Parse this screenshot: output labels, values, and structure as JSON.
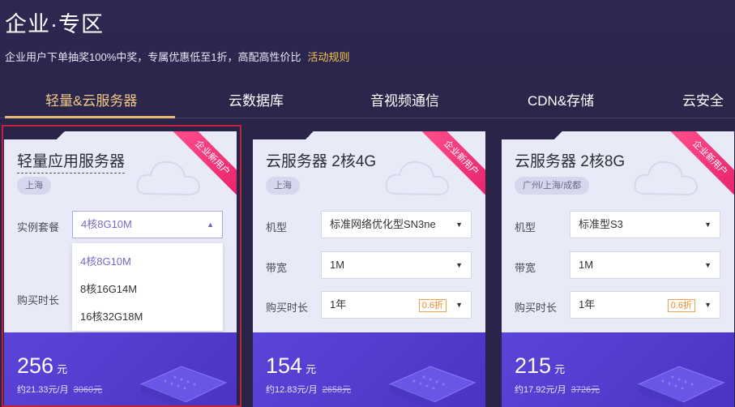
{
  "header": {
    "title": "企业·专区",
    "subtitle": "企业用户下单抽奖100%中奖，专属优惠低至1折，高配高性价比",
    "rule_link": "活动规则"
  },
  "tabs": [
    {
      "label": "轻量&云服务器",
      "active": true
    },
    {
      "label": "云数据库",
      "active": false
    },
    {
      "label": "音视频通信",
      "active": false
    },
    {
      "label": "CDN&存储",
      "active": false
    },
    {
      "label": "云安全",
      "active": false
    }
  ],
  "cards": [
    {
      "ribbon": "企业新用户",
      "name": "轻量应用服务器",
      "region": "上海",
      "rows": [
        {
          "label": "实例套餐",
          "value": "4核8G10M",
          "open": true
        },
        {
          "label": "购买时长",
          "value": ""
        }
      ],
      "dropdown": [
        "4核8G10M",
        "8核16G14M",
        "16核32G18M"
      ],
      "price": "256",
      "price_unit": "元",
      "monthly": "约21.33元/月",
      "original": "3060元"
    },
    {
      "ribbon": "企业新用户",
      "name": "云服务器 2核4G",
      "region": "上海",
      "rows": [
        {
          "label": "机型",
          "value": "标准网络优化型SN3ne"
        },
        {
          "label": "带宽",
          "value": "1M"
        },
        {
          "label": "购买时长",
          "value": "1年",
          "discount": "0.6折"
        }
      ],
      "price": "154",
      "price_unit": "元",
      "monthly": "约12.83元/月",
      "original": "2658元"
    },
    {
      "ribbon": "企业新用户",
      "name": "云服务器 2核8G",
      "region": "广州/上海/成都",
      "rows": [
        {
          "label": "机型",
          "value": "标准型S3"
        },
        {
          "label": "带宽",
          "value": "1M"
        },
        {
          "label": "购买时长",
          "value": "1年",
          "discount": "0.6折"
        }
      ],
      "price": "215",
      "price_unit": "元",
      "monthly": "约17.92元/月",
      "original": "3726元"
    }
  ],
  "colors": {
    "background": "#2a2548",
    "tab_active": "#f2c98a",
    "link": "#f5c64e",
    "ribbon": "#e7226b",
    "price_panel": "#4b34c4",
    "selected_border": "#c0223a"
  },
  "icons": [
    "chevron-down-icon",
    "chevron-up-icon",
    "cloud-icon",
    "server-icon"
  ]
}
